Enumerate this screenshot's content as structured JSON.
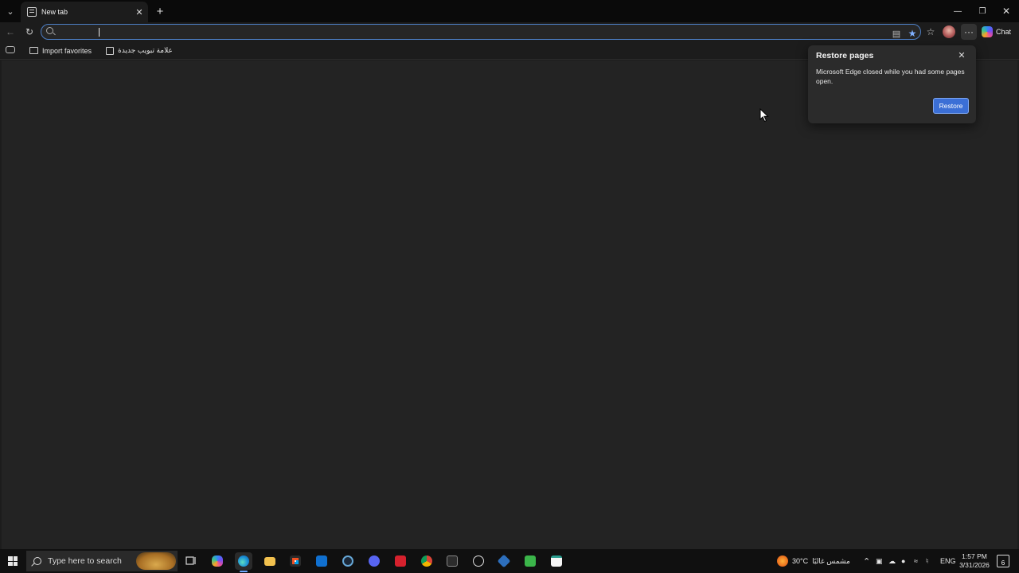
{
  "browser": {
    "tab": {
      "title": "New tab"
    },
    "addressbar": {
      "value": "",
      "placeholder": ""
    },
    "copilot": {
      "label": "Chat"
    },
    "favorites": [
      {
        "label": "Import favorites",
        "icon": "folder-icon"
      },
      {
        "label": "علامة تبويب جديدة",
        "icon": "page-icon"
      }
    ]
  },
  "popup": {
    "title": "Restore pages",
    "message": "Microsoft Edge closed while you had some pages open.",
    "button": "Restore"
  },
  "taskbar": {
    "search_placeholder": "Type here to search",
    "weather": {
      "temp": "30°C",
      "condition": "مشمس غالبًا"
    },
    "language": "ENG",
    "clock": {
      "time": "1:57 PM",
      "date": "3/31/2026"
    },
    "notification_count": "6",
    "apps": [
      "task-view",
      "copilot",
      "edge",
      "file-explorer",
      "microsoft-store",
      "outlook",
      "steam",
      "discord",
      "acrobat",
      "chrome",
      "terminal",
      "github",
      "virtualbox",
      "h-app",
      "notepad"
    ]
  },
  "colors": {
    "accent": "#3b6fd6",
    "addressbar_border": "#4d7fc6",
    "background": "#232323",
    "titlebar": "#0a0a0a"
  }
}
